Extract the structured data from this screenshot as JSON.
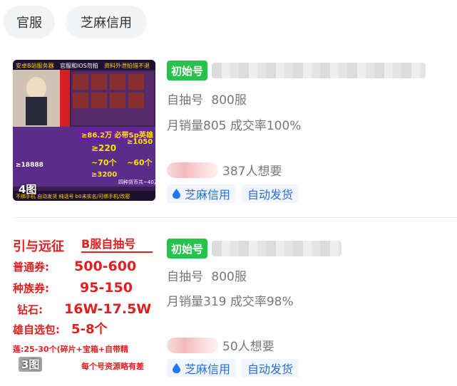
{
  "filter_chips": [
    "官服",
    "芝麻信用"
  ],
  "listings": [
    {
      "badge": "初始号",
      "subtitle": [
        "自抽号",
        "800服"
      ],
      "stats": "月销量805 成交率100%",
      "want": "387人想要",
      "tags": [
        "芝麻信用",
        "自动发货"
      ],
      "image_count": "4图",
      "thumb_texts": {
        "header": [
          "安卓B站服务器",
          "官服和IOS勿拍",
          "资料外泄拍错不退"
        ],
        "s1": "≥86.2万 必带Sp英雄",
        "s2": "≥220",
        "s3": "≥1050",
        "s4": "~70个",
        "s5": "~60个",
        "s6": "≥3200",
        "s7": "≥18888",
        "s8": "四种货币共~40万",
        "footer": "不绑手机 自动发货 纯话号 b0未实名/可绑手机/改密"
      }
    },
    {
      "badge": "初始号",
      "subtitle": [
        "自抽号",
        "800服"
      ],
      "stats": "月销量319 成交率98%",
      "want": "50人想要",
      "tags": [
        "芝麻信用",
        "自动发货"
      ],
      "image_count": "3图",
      "thumb_texts": {
        "title_a": "引与远征",
        "title_b": "B服自抽号",
        "rows": [
          {
            "label": "普通券:",
            "value": "500-600"
          },
          {
            "label": "种族券:",
            "value": "95-150"
          },
          {
            "label": "钻石:",
            "value": "16W-17.5W"
          },
          {
            "label": "雄自选包:",
            "value": "5-8个"
          }
        ],
        "line5": "莲:25-30个(碎片+宝箱+自带精",
        "line6": "每个号资源略有差"
      }
    }
  ],
  "colors": {
    "badge_green": "#27c24c",
    "tag_blue": "#2a6fd6",
    "tag_bg": "#f0f5ff",
    "chip_bg": "#f2f3f5",
    "thumb_red": "#e02020"
  }
}
